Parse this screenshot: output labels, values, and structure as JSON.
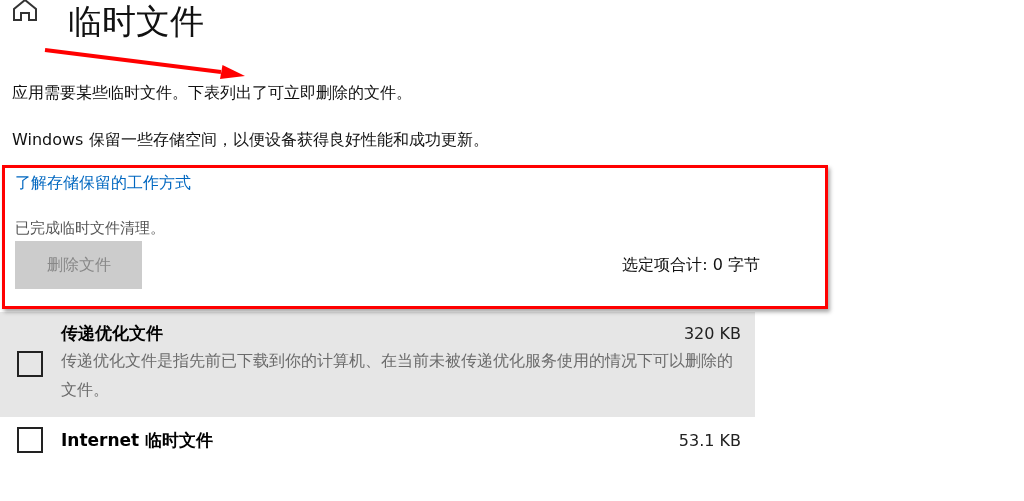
{
  "header": {
    "title": "临时文件"
  },
  "intro": [
    "应用需要某些临时文件。下表列出了可立即删除的文件。",
    "Windows 保留一些存储空间，以便设备获得良好性能和成功更新。"
  ],
  "cleanup": {
    "link": "了解存储保留的工作方式",
    "status": "已完成临时文件清理。",
    "button": {
      "label": "删除文件",
      "disabled": true
    },
    "total": "选定项合计: 0 字节",
    "highlighted": true
  },
  "files": [
    {
      "name": "传递优化文件",
      "size": "320 KB",
      "description": "传递优化文件是指先前已下载到你的计算机、在当前未被传递优化服务使用的情况下可以删除的文件。",
      "checked": false,
      "selected": true
    },
    {
      "name": "Internet 临时文件",
      "size": "53.1 KB",
      "checked": false,
      "selected": false
    }
  ],
  "annotations": [
    {
      "kind": "arrow"
    }
  ]
}
